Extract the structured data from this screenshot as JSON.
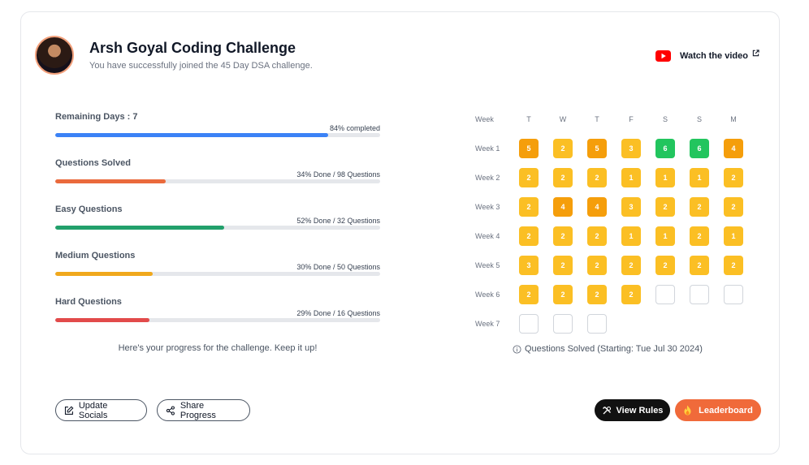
{
  "header": {
    "title": "Arsh Goyal Coding Challenge",
    "subtitle": "You have successfully joined the 45 Day DSA challenge.",
    "watch_label": "Watch the video"
  },
  "progress": [
    {
      "label": "Remaining Days : 7",
      "status": "84% completed",
      "percent": 84,
      "color": "#3b82f6"
    },
    {
      "label": "Questions Solved",
      "status": "34% Done / 98 Questions",
      "percent": 34,
      "color": "#ea6a3c"
    },
    {
      "label": "Easy Questions",
      "status": "52% Done / 32 Questions",
      "percent": 52,
      "color": "#22a06b"
    },
    {
      "label": "Medium Questions",
      "status": "30% Done / 50 Questions",
      "percent": 30,
      "color": "#f0a81c"
    },
    {
      "label": "Hard Questions",
      "status": "29% Done / 16 Questions",
      "percent": 29,
      "color": "#e24b4b"
    }
  ],
  "progress_footer": "Here's your progress for the challenge. Keep it up!",
  "calendar": {
    "week_header": "Week",
    "days": [
      "T",
      "W",
      "T",
      "F",
      "S",
      "S",
      "M"
    ],
    "weeks": [
      {
        "label": "Week 1",
        "values": [
          5,
          2,
          5,
          3,
          6,
          6,
          4
        ]
      },
      {
        "label": "Week 2",
        "values": [
          2,
          2,
          2,
          1,
          1,
          1,
          2
        ]
      },
      {
        "label": "Week 3",
        "values": [
          2,
          4,
          4,
          3,
          2,
          2,
          2
        ]
      },
      {
        "label": "Week 4",
        "values": [
          2,
          2,
          2,
          1,
          1,
          2,
          1
        ]
      },
      {
        "label": "Week 5",
        "values": [
          3,
          2,
          2,
          2,
          2,
          2,
          2
        ]
      },
      {
        "label": "Week 6",
        "values": [
          2,
          2,
          2,
          2,
          null,
          null,
          null
        ]
      },
      {
        "label": "Week 7",
        "values": [
          null,
          null,
          null
        ]
      }
    ],
    "colors": {
      "low": "#fbbf24",
      "mid": "#f59e0b",
      "high": "#22c55e"
    },
    "footer": "Questions Solved (Starting: Tue Jul 30 2024)"
  },
  "buttons": {
    "update_socials": "Update Socials",
    "share_progress": "Share Progress",
    "view_rules": "View Rules",
    "leaderboard": "Leaderboard"
  }
}
